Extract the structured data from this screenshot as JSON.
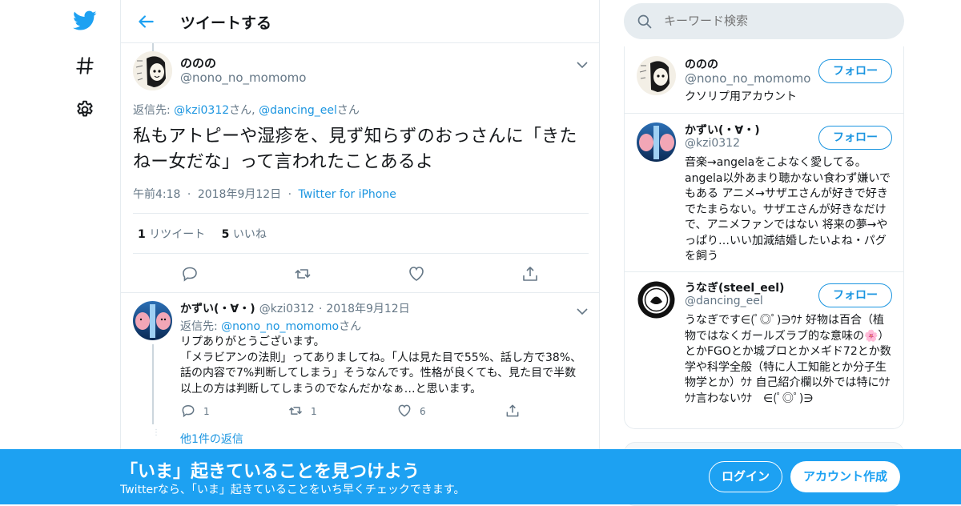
{
  "header": {
    "title": "ツイートする"
  },
  "tweet": {
    "name": "ののの",
    "handle": "@nono_no_momomo",
    "reply_to_prefix": "返信先: ",
    "reply_to_user1": "@kzi0312",
    "reply_to_sep": "さん, ",
    "reply_to_user2": "@dancing_eel",
    "reply_to_suffix": "さん",
    "text": "私もアトピーや湿疹を、見ず知らずのおっさんに「きたねー女だな」って言われたことあるよ",
    "time": "午前4:18",
    "date": "2018年9月12日",
    "source": "Twitter for iPhone",
    "retweet_count": "1",
    "retweet_label": "リツイート",
    "like_count": "5",
    "like_label": "いいね"
  },
  "reply": {
    "name": "かずい(・∀・)",
    "handle": "@kzi0312",
    "date": "2018年9月12日",
    "reply_to_prefix": "返信先: ",
    "reply_to_user": "@nono_no_momomo",
    "reply_to_suffix": "さん",
    "text": "リプありがとうございます。\n「メラビアンの法則」ってありましてね。「人は見た目で55%、話し方で38%、話の内容で7%判断してしまう」そうなんです。性格が良くても、見た目で半数以上の方は判断してしまうのでなんだかなぁ…と思います。",
    "reply_count": "1",
    "retweet_count": "1",
    "like_count": "6",
    "more_replies": "他1件の返信"
  },
  "search": {
    "placeholder": "キーワード検索"
  },
  "users": [
    {
      "name": "ののの",
      "handle": "@nono_no_momomo",
      "bio": "クソリプ用アカウント",
      "follow": "フォロー"
    },
    {
      "name": "かずい(・∀・)",
      "handle": "@kzi0312",
      "bio": "音楽→angelaをこよなく愛してる。angela以外あまり聴かない食わず嫌いでもある アニメ→サザエさんが好きで好きでたまらない。サザエさんが好きなだけで、アニメファンではない 将来の夢→やっぱり…いい加減結婚したいよね・パグを飼う",
      "follow": "フォロー"
    },
    {
      "name": "うなぎ(steel_eel)",
      "handle": "@dancing_eel",
      "bio": "うなぎです∈(ﾟ◎ﾟ)∋ｳﾅ 好物は百合（植物ではなくガールズラブ的な意味の🌸）とかFGOとか城プロとかメギド72とか数学や科学全般（特に人工知能とか分子生物学とか）ｳﾅ 自己紹介欄以外では特にｳﾅｳﾅ言わないｳﾅ　∈(ﾟ◎ﾟ)∋",
      "follow": "フォロー"
    }
  ],
  "banner": {
    "title": "「いま」起きていることを見つけよう",
    "subtitle": "Twitterなら、「いま」起きていることをいち早くチェックできます。",
    "login": "ログイン",
    "signup": "アカウント作成"
  },
  "colors": {
    "accent": "#1da1f2",
    "link": "#1b95e0",
    "muted": "#657786",
    "border": "#e6ecf0"
  },
  "icons": [
    "twitter-bird-icon",
    "hashtag-icon",
    "gear-icon",
    "back-arrow-icon",
    "chevron-down-icon",
    "reply-icon",
    "retweet-icon",
    "heart-icon",
    "share-icon",
    "search-icon"
  ]
}
